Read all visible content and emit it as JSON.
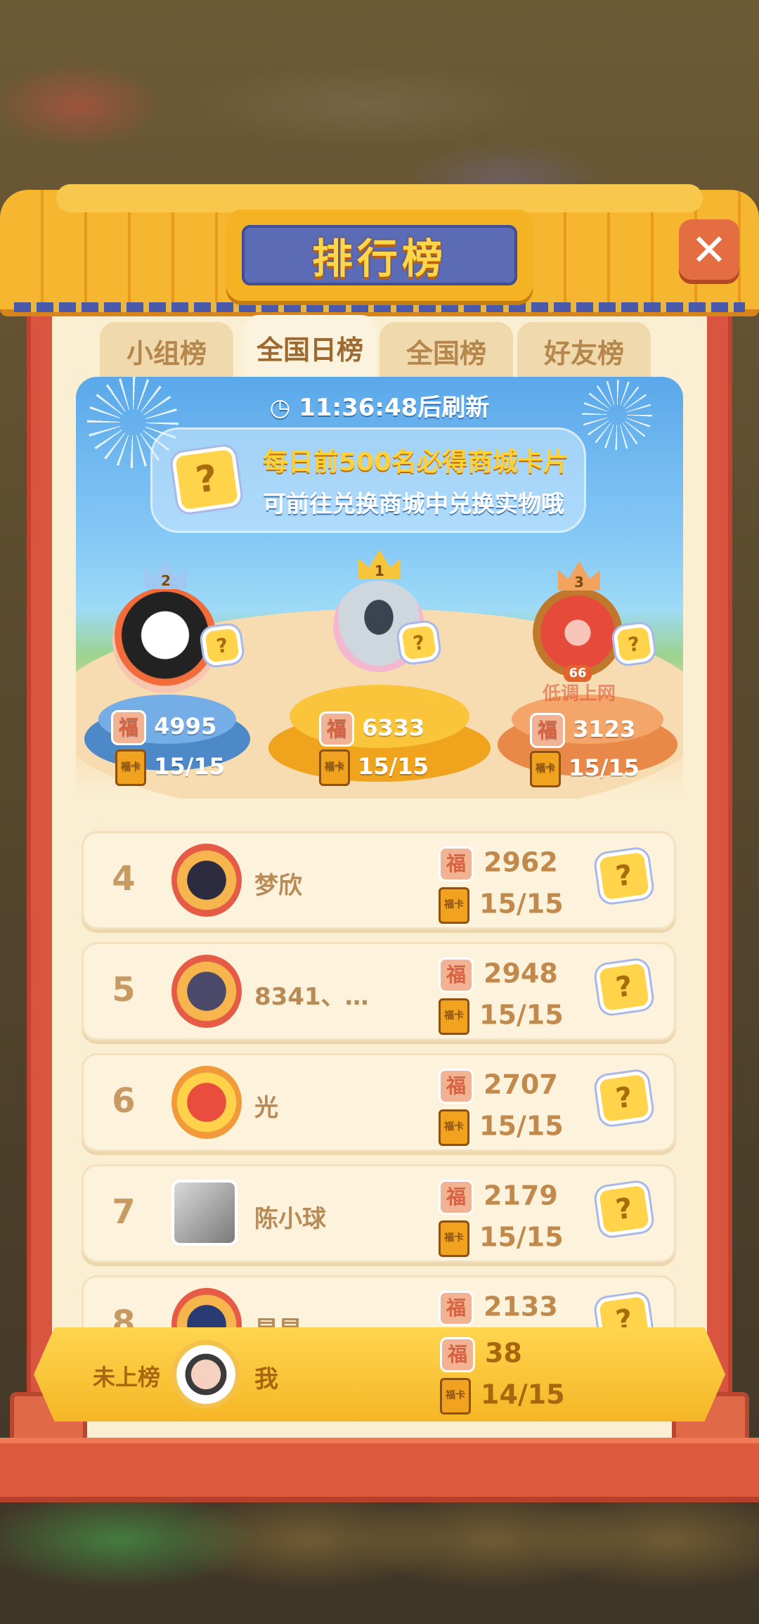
{
  "title": "排行榜",
  "tabs": [
    {
      "label": "小组榜",
      "active": false
    },
    {
      "label": "全国日榜",
      "active": true
    },
    {
      "label": "全国榜",
      "active": false
    },
    {
      "label": "好友榜",
      "active": false
    }
  ],
  "timer": "11:36:48后刷新",
  "banner": {
    "line1": "每日前500名必得商城卡片",
    "line2": "可前往兑换商城中兑换实物哦"
  },
  "badges": {
    "fu": "福",
    "book": "福卡",
    "card": "?"
  },
  "podium": [
    {
      "rank": "1",
      "score": "6333",
      "progress": "15/15"
    },
    {
      "rank": "2",
      "score": "4995",
      "progress": "15/15"
    },
    {
      "rank": "3",
      "score": "3123",
      "progress": "15/15",
      "level": "66",
      "watermark": "低调上网"
    }
  ],
  "rows": [
    {
      "rank": "4",
      "name": "梦欣",
      "score": "2962",
      "progress": "15/15"
    },
    {
      "rank": "5",
      "name": "8341、…",
      "score": "2948",
      "progress": "15/15"
    },
    {
      "rank": "6",
      "name": "光",
      "score": "2707",
      "progress": "15/15"
    },
    {
      "rank": "7",
      "name": "陈小球",
      "score": "2179",
      "progress": "15/15"
    },
    {
      "rank": "8",
      "name": "星星",
      "score": "2133",
      "progress": ""
    }
  ],
  "me": {
    "rank_label": "未上榜",
    "name": "我",
    "score": "38",
    "progress": "14/15"
  },
  "colors": {
    "frame": "#d9553f",
    "panel": "#fbefd3",
    "gold": "#f5b324",
    "plaque": "#5b6bb5",
    "sky": "#5aa8ea"
  },
  "icons": [
    "clock-icon",
    "close-icon",
    "crown-icon",
    "fu-badge-icon",
    "book-icon",
    "mystery-card-icon"
  ]
}
